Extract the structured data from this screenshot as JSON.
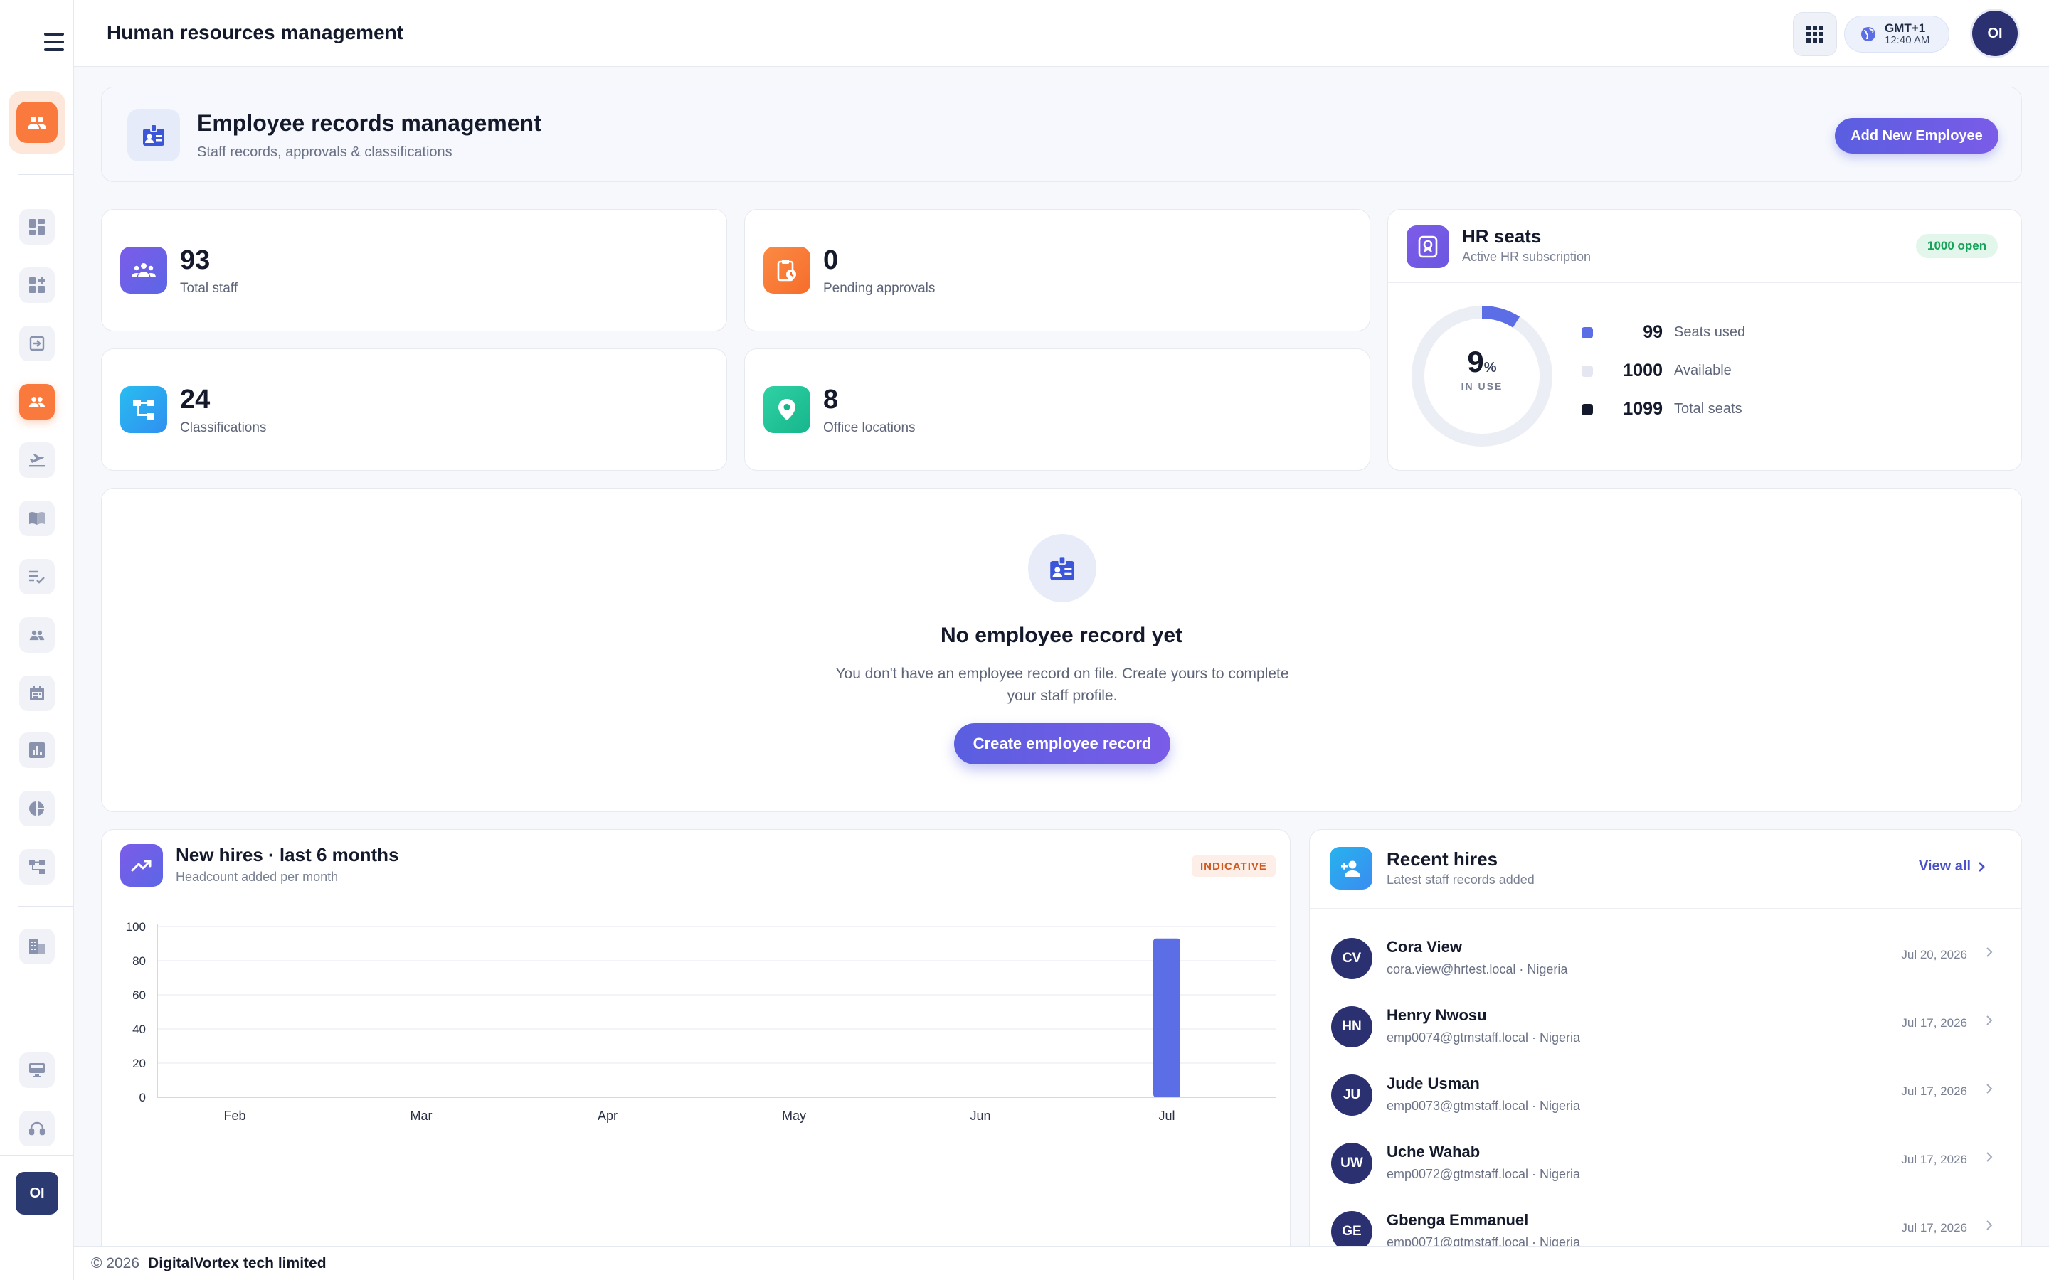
{
  "app": {
    "title": "Human resources management"
  },
  "topbar": {
    "timezone": "GMT+1",
    "time": "12:40 AM",
    "user_initials": "OI"
  },
  "sidebar": {
    "items": [
      {
        "icon": "dashboard-icon"
      },
      {
        "icon": "widgets-icon"
      },
      {
        "icon": "login-icon"
      },
      {
        "icon": "people-icon",
        "active": true
      },
      {
        "icon": "flight-icon"
      },
      {
        "icon": "book-icon"
      },
      {
        "icon": "checklist-icon"
      },
      {
        "icon": "group-icon"
      },
      {
        "icon": "calendar-icon"
      },
      {
        "icon": "bar-chart-icon"
      },
      {
        "icon": "pie-chart-icon"
      },
      {
        "icon": "hierarchy-icon"
      },
      {
        "icon": "building-icon"
      },
      {
        "icon": "desktop-icon"
      },
      {
        "icon": "support-icon"
      }
    ],
    "user_initials": "OI"
  },
  "hero": {
    "title": "Employee records management",
    "subtitle": "Staff records, approvals & classifications",
    "add_button": "Add New Employee"
  },
  "stats": {
    "total_staff": {
      "value": "93",
      "label": "Total staff"
    },
    "pending": {
      "value": "0",
      "label": "Pending approvals"
    },
    "classifications": {
      "value": "24",
      "label": "Classifications"
    },
    "offices": {
      "value": "8",
      "label": "Office locations"
    }
  },
  "seats": {
    "title": "HR seats",
    "subtitle": "Active HR subscription",
    "badge": "1000 open",
    "percent": "9",
    "percent_unit": "%",
    "in_use_label": "IN USE",
    "in_use_fraction": 0.09,
    "used": {
      "value": "99",
      "label": "Seats used",
      "color": "#5b6ee6"
    },
    "available": {
      "value": "1000",
      "label": "Available",
      "color": "#e4e7f2"
    },
    "total": {
      "value": "1099",
      "label": "Total seats",
      "color": "#141a2b"
    }
  },
  "empty": {
    "title": "No employee record yet",
    "message": "You don't have an employee record on file. Create yours to complete your staff profile.",
    "button": "Create employee record"
  },
  "new_hires": {
    "title": "New hires · last 6 months",
    "subtitle": "Headcount added per month",
    "badge": "INDICATIVE"
  },
  "chart_data": {
    "type": "bar",
    "categories": [
      "Feb",
      "Mar",
      "Apr",
      "May",
      "Jun",
      "Jul"
    ],
    "values": [
      0,
      0,
      0,
      0,
      0,
      93
    ],
    "ylim": [
      0,
      100
    ],
    "yticks": [
      0,
      20,
      40,
      60,
      80,
      100
    ],
    "color": "#5b6ee6",
    "grid": true
  },
  "recent": {
    "title": "Recent hires",
    "subtitle": "Latest staff records added",
    "view_all": "View all",
    "hires": [
      {
        "initials": "CV",
        "name": "Cora View",
        "email": "cora.view@hrtest.local · Nigeria",
        "date": "Jul 20, 2026"
      },
      {
        "initials": "HN",
        "name": "Henry Nwosu",
        "email": "emp0074@gtmstaff.local · Nigeria",
        "date": "Jul 17, 2026"
      },
      {
        "initials": "JU",
        "name": "Jude Usman",
        "email": "emp0073@gtmstaff.local · Nigeria",
        "date": "Jul 17, 2026"
      },
      {
        "initials": "UW",
        "name": "Uche Wahab",
        "email": "emp0072@gtmstaff.local · Nigeria",
        "date": "Jul 17, 2026"
      },
      {
        "initials": "GE",
        "name": "Gbenga Emmanuel",
        "email": "emp0071@gtmstaff.local · Nigeria",
        "date": "Jul 17, 2026"
      }
    ]
  },
  "footer": {
    "copyright": "© 2026",
    "company": "DigitalVortex tech limited"
  }
}
